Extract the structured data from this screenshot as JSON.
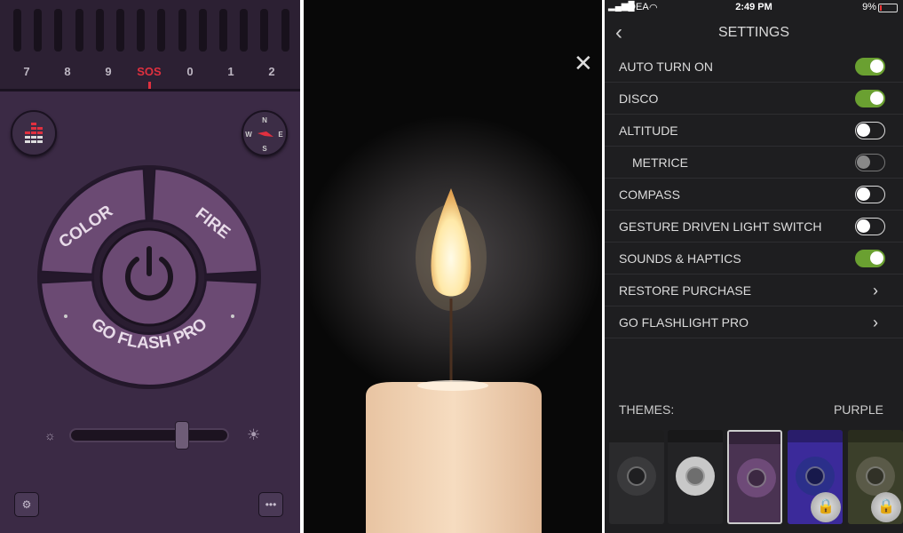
{
  "left": {
    "dial_numbers": [
      "7",
      "8",
      "9",
      "SOS",
      "0",
      "1",
      "2"
    ],
    "selected_mode": "SOS",
    "segments": {
      "color": "COLOR",
      "fire": "FIRE",
      "pro": "GO FLASH PRO"
    },
    "icons": {
      "equalizer": "equalizer-icon",
      "compass": "compass-icon",
      "power": "power-icon",
      "settings": "gear-icon",
      "more": "more-icon"
    },
    "compass_letters": {
      "n": "N",
      "e": "E",
      "s": "S",
      "w": "W"
    },
    "more_label": "•••",
    "brightness": 0.73,
    "accent": "#e0303f"
  },
  "middle": {
    "close_icon": "close-icon"
  },
  "right": {
    "status": {
      "carrier": "IDEA",
      "time": "2:49 PM",
      "battery": "9%"
    },
    "title": "SETTINGS",
    "rows": [
      {
        "label": "AUTO TURN ON",
        "type": "toggle",
        "on": true
      },
      {
        "label": "DISCO",
        "type": "toggle",
        "on": true
      },
      {
        "label": "ALTITUDE",
        "type": "toggle",
        "on": false
      },
      {
        "label": "METRICE",
        "type": "toggle",
        "on": false,
        "disabled": true,
        "sub": true
      },
      {
        "label": "COMPASS",
        "type": "toggle",
        "on": false
      },
      {
        "label": "GESTURE DRIVEN LIGHT SWITCH",
        "type": "toggle",
        "on": false
      },
      {
        "label": "SOUNDS & HAPTICS",
        "type": "toggle",
        "on": true
      },
      {
        "label": "RESTORE PURCHASE",
        "type": "link"
      },
      {
        "label": "GO FLASHLIGHT PRO",
        "type": "link"
      }
    ],
    "themes_label": "THEMES:",
    "current_theme": "PURPLE",
    "themes": [
      {
        "bg": "#2a2a2c",
        "ring": "#3a3a3c",
        "locked": false,
        "selected": false
      },
      {
        "bg": "#232325",
        "ring": "#c8c8c8",
        "locked": false,
        "selected": false
      },
      {
        "bg": "#4a3352",
        "ring": "#6e4a78",
        "locked": false,
        "selected": true
      },
      {
        "bg": "#3b2a9a",
        "ring": "#2b2f8a",
        "locked": true,
        "selected": false
      },
      {
        "bg": "#3b3f2a",
        "ring": "#5a5a48",
        "locked": true,
        "selected": false
      }
    ],
    "toggle_on_color": "#6aa031"
  }
}
